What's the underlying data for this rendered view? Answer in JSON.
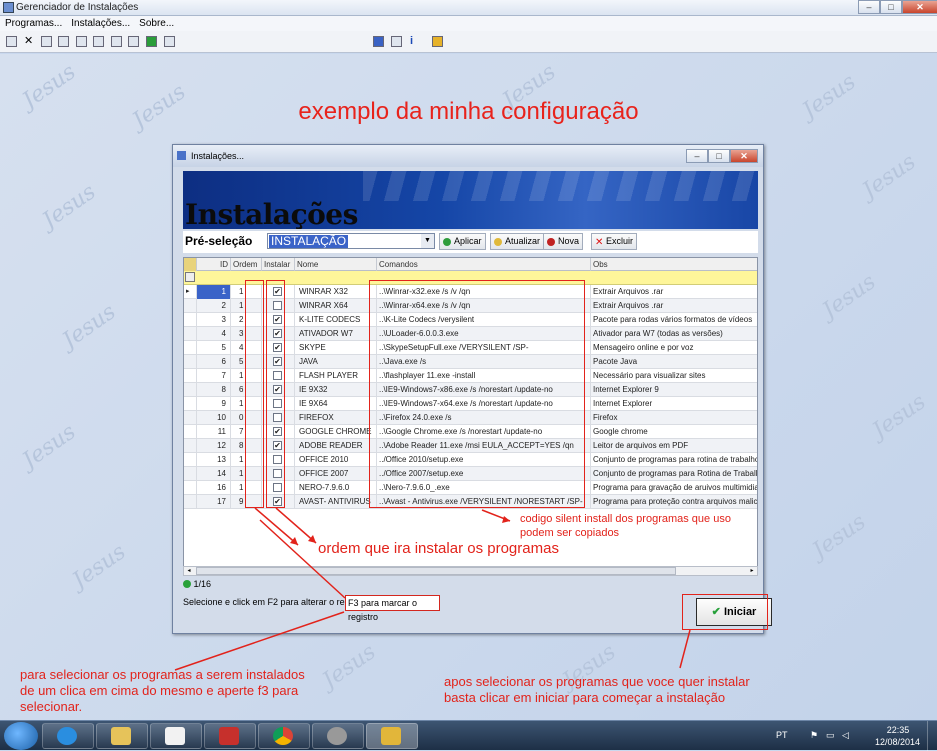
{
  "app": {
    "title": "Gerenciador de Instalações"
  },
  "menu": [
    "Programas...",
    "Instalações...",
    "Sobre..."
  ],
  "heading": "exemplo da minha configuração",
  "window": {
    "title": "Instalações...",
    "banner": "Instalações",
    "preset": {
      "label": "Pré-seleção",
      "value": "INSTALAÇÃO"
    },
    "buttons": {
      "apply": "Aplicar",
      "update": "Atualizar",
      "new": "Nova",
      "delete": "Excluir"
    },
    "columns": [
      "ID",
      "Ordem",
      "Instalar",
      "Nome",
      "Comandos",
      "Obs"
    ],
    "rows": [
      {
        "id": "1",
        "ordem": "1",
        "inst": true,
        "nome": "WINRAR X32",
        "cmd": "..\\Winrar-x32.exe /s /v /qn",
        "obs": "Extrair Arquivos .rar",
        "sel": true
      },
      {
        "id": "2",
        "ordem": "1",
        "inst": false,
        "nome": "WINRAR X64",
        "cmd": "..\\Winrar-x64.exe /s /v /qn",
        "obs": "Extrair Arquivos .rar"
      },
      {
        "id": "3",
        "ordem": "2",
        "inst": true,
        "nome": "K-LITE CODECS",
        "cmd": "..\\K-Lite Codecs /verysilent",
        "obs": "Pacote para rodas vários formatos de vídeos"
      },
      {
        "id": "4",
        "ordem": "3",
        "inst": true,
        "nome": "ATIVADOR W7",
        "cmd": "..\\ULoader-6.0.0.3.exe",
        "obs": "Ativador para W7 (todas as versões)"
      },
      {
        "id": "5",
        "ordem": "4",
        "inst": true,
        "nome": "SKYPE",
        "cmd": "..\\SkypeSetupFull.exe /VERYSILENT /SP-",
        "obs": "Mensageiro online e por voz"
      },
      {
        "id": "6",
        "ordem": "5",
        "inst": true,
        "nome": "JAVA",
        "cmd": "..\\Java.exe /s",
        "obs": "Pacote Java"
      },
      {
        "id": "7",
        "ordem": "1",
        "inst": false,
        "nome": "FLASH PLAYER",
        "cmd": "..\\flashplayer 11.exe -install",
        "obs": "Necessário para visualizar sites"
      },
      {
        "id": "8",
        "ordem": "6",
        "inst": true,
        "nome": "IE 9X32",
        "cmd": "..\\IE9-Windows7-x86.exe /s /norestart /update-no",
        "obs": "Internet Explorer 9"
      },
      {
        "id": "9",
        "ordem": "1",
        "inst": false,
        "nome": "IE 9X64",
        "cmd": "..\\IE9-Windows7-x64.exe /s /norestart /update-no",
        "obs": "Internet Explorer"
      },
      {
        "id": "10",
        "ordem": "0",
        "inst": false,
        "nome": "FIREFOX",
        "cmd": "..\\Firefox 24.0.exe /s",
        "obs": "Firefox"
      },
      {
        "id": "11",
        "ordem": "7",
        "inst": true,
        "nome": "GOOGLE CHROME",
        "cmd": "..\\Google Chrome.exe /s /norestart /update-no",
        "obs": "Google chrome"
      },
      {
        "id": "12",
        "ordem": "8",
        "inst": true,
        "nome": "ADOBE READER",
        "cmd": "..\\Adobe Reader 11.exe /msi EULA_ACCEPT=YES /qn",
        "obs": "Leitor de arquivos em PDF"
      },
      {
        "id": "13",
        "ordem": "1",
        "inst": false,
        "nome": "OFFICE 2010",
        "cmd": "../Office 2010/setup.exe",
        "obs": "Conjunto de programas para rotina de trabalho"
      },
      {
        "id": "14",
        "ordem": "1",
        "inst": false,
        "nome": "OFFICE 2007",
        "cmd": "../Office 2007/setup.exe",
        "obs": "Conjunto de programas para Rotina de Trabalho"
      },
      {
        "id": "16",
        "ordem": "1",
        "inst": false,
        "nome": "NERO-7.9.6.0",
        "cmd": "..\\Nero-7.9.6.0_.exe",
        "obs": "Programa para gravação de aruivos multimidia"
      },
      {
        "id": "17",
        "ordem": "9",
        "inst": true,
        "nome": "AVAST- ANTIVIRUS",
        "cmd": "..\\Avast - Antivirus.exe /VERYSILENT /NORESTART /SP-",
        "obs": "Programa para proteção contra arquivos malicios"
      }
    ],
    "record": "1/16",
    "status": "Selecione e click em F2 para alterar o registro",
    "f3": "F3 para marcar o registro",
    "start": "Iniciar"
  },
  "annotations": {
    "silent": "codigo silent install dos programas que uso\npodem ser copiados",
    "order": "ordem que ira instalar os programas",
    "select": "para selecionar os programas a serem instalados\nde um clica em cima do mesmo e aperte f3 para\nselecionar.",
    "start": "apos selecionar os programas que voce quer instalar\nbasta clicar em iniciar para começar a instalação"
  },
  "watermark": "Jesus",
  "taskbar": {
    "lang": "PT",
    "time": "22:35",
    "date": "12/08/2014"
  }
}
